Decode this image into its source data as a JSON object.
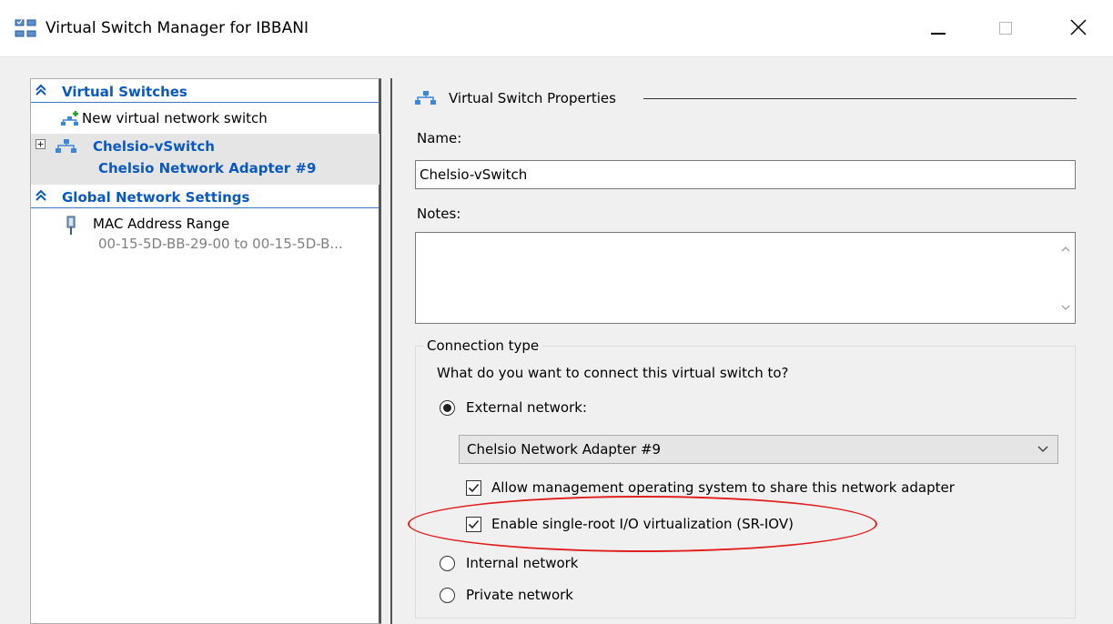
{
  "window": {
    "title": "Virtual Switch Manager for IBBANI"
  },
  "sidebar": {
    "virtual_switches_header": "Virtual Switches",
    "new_switch_label": "New virtual network switch",
    "switch_name": "Chelsio-vSwitch",
    "switch_adapter": "Chelsio Network Adapter #9",
    "global_header": "Global Network Settings",
    "mac_label": "MAC Address Range",
    "mac_value": "00-15-5D-BB-29-00 to 00-15-5D-B..."
  },
  "properties": {
    "section_title": "Virtual Switch Properties",
    "name_label": "Name:",
    "name_value": "Chelsio-vSwitch",
    "notes_label": "Notes:",
    "notes_value": ""
  },
  "connection": {
    "group_label": "Connection type",
    "question": "What do you want to connect this virtual switch to?",
    "external_label": "External network:",
    "adapter_selected": "Chelsio Network Adapter #9",
    "allow_mgmt_label": "Allow management operating system to share this network adapter",
    "sriov_label": "Enable single-root I/O virtualization (SR-IOV)",
    "internal_label": "Internal network",
    "private_label": "Private network",
    "selected": "External network:",
    "allow_mgmt_checked": true,
    "sriov_checked": true
  },
  "colors": {
    "accent_blue": "#0a58c2",
    "highlight_red": "#e02020"
  }
}
